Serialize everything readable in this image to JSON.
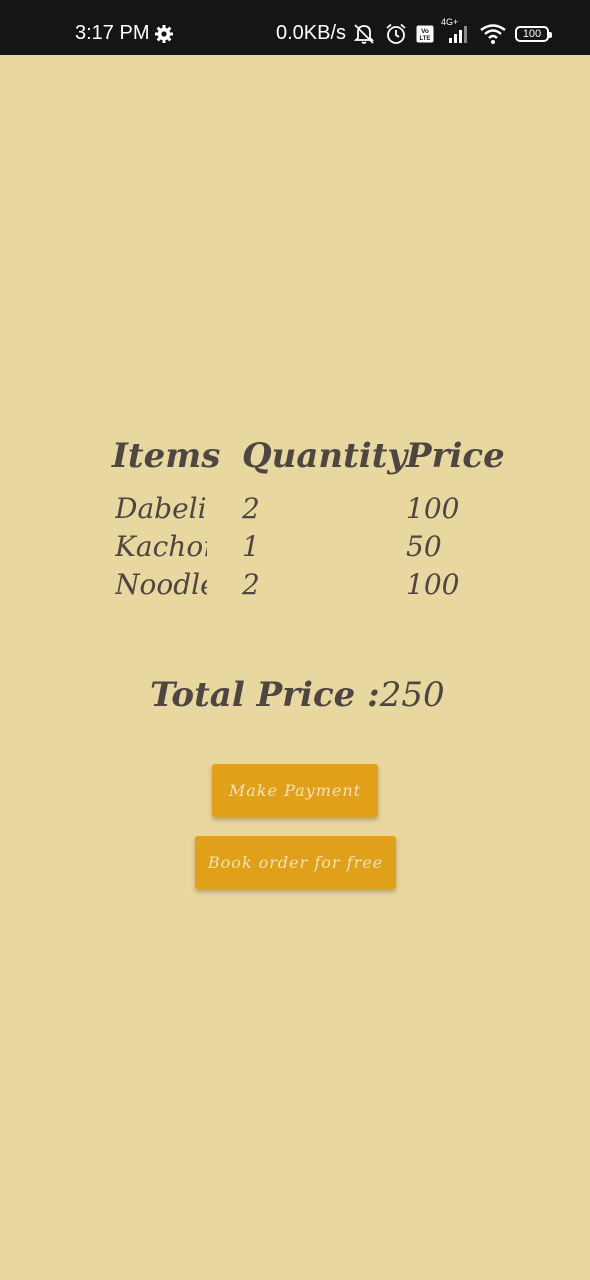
{
  "status_bar": {
    "time": "3:17 PM",
    "net_speed": "0.0KB/s",
    "network_type": "4G+",
    "volte_label": "Vo LTE",
    "battery": "100"
  },
  "order_table": {
    "headers": {
      "items": "Items",
      "quantity": "Quantity",
      "price": "Price"
    },
    "rows": [
      {
        "item": "Dabeli",
        "quantity": "2",
        "price": "100"
      },
      {
        "item": "Kachori",
        "quantity": "1",
        "price": "50"
      },
      {
        "item": "Noodles",
        "quantity": "2",
        "price": "100"
      }
    ]
  },
  "total": {
    "label": "Total Price :",
    "value": "250"
  },
  "buttons": {
    "make_payment": "Make Payment",
    "book_order": "Book order for free"
  },
  "colors": {
    "background": "#e9d7a0",
    "button": "#e1a01a",
    "text": "#4e4642"
  }
}
